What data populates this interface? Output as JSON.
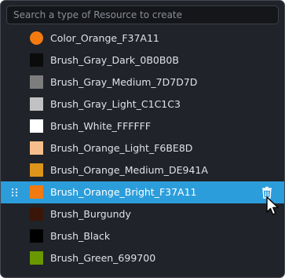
{
  "search": {
    "placeholder": "Search a type of Resource to create",
    "value": ""
  },
  "items": [
    {
      "label": "Color_Orange_F37A11",
      "color": "#F37A11",
      "shape": "circle"
    },
    {
      "label": "Brush_Gray_Dark_0B0B0B",
      "color": "#0B0B0B",
      "shape": "square"
    },
    {
      "label": "Brush_Gray_Medium_7D7D7D",
      "color": "#7D7D7D",
      "shape": "square"
    },
    {
      "label": "Brush_Gray_Light_C1C1C3",
      "color": "#C1C1C3",
      "shape": "square"
    },
    {
      "label": "Brush_White_FFFFFF",
      "color": "#FFFFFF",
      "shape": "square"
    },
    {
      "label": "Brush_Orange_Light_F6BE8D",
      "color": "#F6BE8D",
      "shape": "square"
    },
    {
      "label": "Brush_Orange_Medium_DE941A",
      "color": "#DE941A",
      "shape": "square"
    },
    {
      "label": "Brush_Orange_Bright_F37A11",
      "color": "#F37A11",
      "shape": "square",
      "selected": true
    },
    {
      "label": "Brush_Burgundy",
      "color": "#3A1608",
      "shape": "square"
    },
    {
      "label": "Brush_Black",
      "color": "#000000",
      "shape": "square"
    },
    {
      "label": "Brush_Green_699700",
      "color": "#699700",
      "shape": "square"
    }
  ],
  "icons": {
    "drag": "drag-handle-icon",
    "delete": "trash-icon",
    "pointer": "mouse-cursor-icon"
  },
  "colors": {
    "panel_bg": "#202329",
    "selection": "#2C9DDB",
    "text": "#DFE2E6"
  }
}
